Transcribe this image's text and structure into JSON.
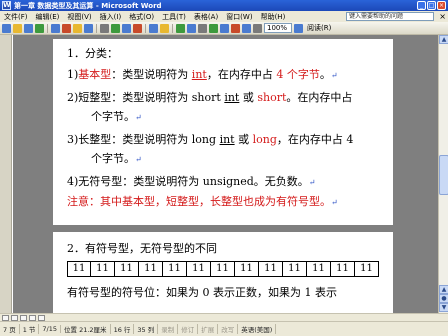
{
  "window": {
    "title": "第一章 数据类型及其运算 - Microsoft Word",
    "min": "_",
    "max": "□",
    "close": "×"
  },
  "menu": {
    "items": [
      "文件(F)",
      "编辑(E)",
      "视图(V)",
      "插入(I)",
      "格式(O)",
      "工具(T)",
      "表格(A)",
      "窗口(W)",
      "帮助(H)"
    ],
    "help_placeholder": "键入需要帮助的问题",
    "close": "×"
  },
  "toolbar": {
    "zoom": "100%",
    "read": "阅读(R)",
    "colors": {
      "icons": [
        "#4a7bd0",
        "#e8b830",
        "#4a7bd0",
        "#3d9a3d",
        "#4a7bd0",
        "#c84a2a",
        "#e8b830",
        "#4a7bd0",
        "#7a7a7a",
        "#3d9a3d",
        "#4a7bd0",
        "#c84a2a",
        "#4a7bd0",
        "#e8b830",
        "#3d9a3d",
        "#4a7bd0",
        "#7a7a7a",
        "#c84a2a"
      ]
    }
  },
  "document": {
    "page1": {
      "heading": "1．分类：",
      "item1": {
        "prefix": "1)",
        "label": "基本型",
        "rest1": "：类型说明符为 ",
        "kw": "int",
        "rest2": "，在内存中占 ",
        "size": "4 个字节",
        "end": "。"
      },
      "item2a": {
        "prefix": "2)短整型：类型说明符为 short ",
        "kw1": "int",
        "mid": " 或 ",
        "kw2": "short",
        "rest": "。在内存中占"
      },
      "item2b": "个字节。",
      "item3a": {
        "prefix": "3)长整型：类型说明符为 long ",
        "kw1": "int",
        "mid": " 或 ",
        "kw2": "long",
        "rest": "，在内存中占 4"
      },
      "item3b": "个字节。",
      "item4": "4)无符号型：类型说明符为 unsigned。无负数。",
      "note": "注意：其中基本型，短整型，长整型也成为有符号型。",
      "pilcrow": "↵"
    },
    "page2": {
      "heading": "2．有符号型，无符号型的不同",
      "cells": [
        "11",
        "11",
        "11",
        "11",
        "11",
        "11",
        "11",
        "11",
        "11",
        "11",
        "11",
        "11",
        "11"
      ],
      "bottom": "有符号型的符号位：如果为 0 表示正数，如果为 1 表示"
    }
  },
  "status": {
    "page": "7 页",
    "section": "1 节",
    "pages": "7/15",
    "position": "位置 21.2厘米",
    "line": "16 行",
    "col": "35 列",
    "rec": "录制",
    "trk": "修订",
    "ext": "扩展",
    "ovr": "改写",
    "lang": "英语(美国)"
  }
}
